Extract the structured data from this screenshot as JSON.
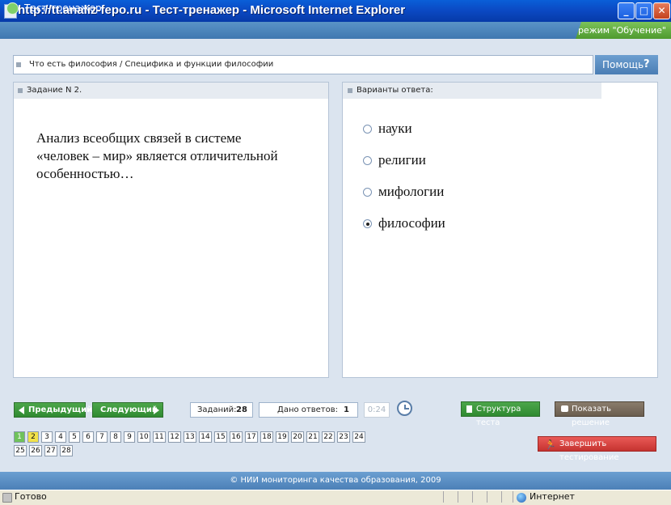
{
  "window": {
    "title": "http://tt.analiz-fepo.ru - Тест-тренажер - Microsoft Internet Explorer"
  },
  "app": {
    "title": "Тест-тренажер",
    "mode": "режим \"Обучение\""
  },
  "topic": {
    "text": "Что есть философия / Специфика и функции философии",
    "help_label": "Помощь",
    "help_icon": "?"
  },
  "task": {
    "header": "Задание N 2.",
    "question": "Анализ всеобщих связей в системе «человек – мир» является отличительной особенностью…"
  },
  "answers": {
    "header": "Варианты ответа:",
    "options": [
      {
        "label": "науки",
        "selected": false
      },
      {
        "label": "религии",
        "selected": false
      },
      {
        "label": "мифологии",
        "selected": false
      },
      {
        "label": "философии",
        "selected": true
      }
    ]
  },
  "controls": {
    "prev_label": "Предыдущий",
    "next_label": "Следующий",
    "tasks_label": "Заданий:",
    "tasks_count": "28",
    "answers_label": "Дано ответов:",
    "answers_count": "1",
    "timer": "0:24",
    "structure_label": "Структура теста",
    "show_solution_label": "Показать решение",
    "finish_label": "Завершить тестирование"
  },
  "task_numbers": [
    "1",
    "2",
    "3",
    "4",
    "5",
    "6",
    "7",
    "8",
    "9",
    "10",
    "11",
    "12",
    "13",
    "14",
    "15",
    "16",
    "17",
    "18",
    "19",
    "20",
    "21",
    "22",
    "23",
    "24",
    "25",
    "26",
    "27",
    "28"
  ],
  "task_states": {
    "answered": [
      "1"
    ],
    "current": "2"
  },
  "footer": {
    "text": "© НИИ мониторинга качества образования, 2009"
  },
  "statusbar": {
    "status": "Готово",
    "zone": "Интернет"
  },
  "colors": {
    "accent_blue": "#4c80b7",
    "green": "#2f8a31",
    "finish_red": "#d9413f",
    "current_yellow": "#f2e24a",
    "answered_green": "#6fc25a"
  }
}
